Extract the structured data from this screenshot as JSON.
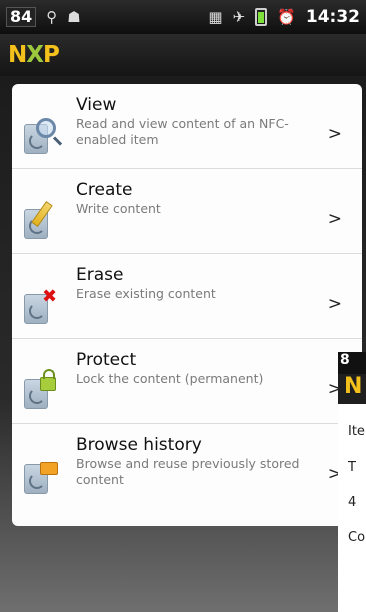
{
  "status_bar": {
    "notification_count": "84",
    "time": "14:32"
  },
  "app": {
    "logo": {
      "n": "N",
      "x": "X",
      "p": "P"
    }
  },
  "menu": {
    "items": [
      {
        "title": "View",
        "description": "Read and view content of an NFC-enabled item",
        "icon": "view-tag-icon"
      },
      {
        "title": "Create",
        "description": "Write content",
        "icon": "create-tag-icon"
      },
      {
        "title": "Erase",
        "description": "Erase existing content",
        "icon": "erase-tag-icon"
      },
      {
        "title": "Protect",
        "description": "Lock the content (permanent)",
        "icon": "protect-tag-icon"
      },
      {
        "title": "Browse history",
        "description": "Browse and reuse previously stored content",
        "icon": "history-tag-icon"
      }
    ],
    "chevron": ">"
  },
  "overlay_window": {
    "status_text": "8",
    "logo_letter": "N",
    "lines": [
      "Ite",
      "T",
      "4",
      "Co"
    ]
  }
}
